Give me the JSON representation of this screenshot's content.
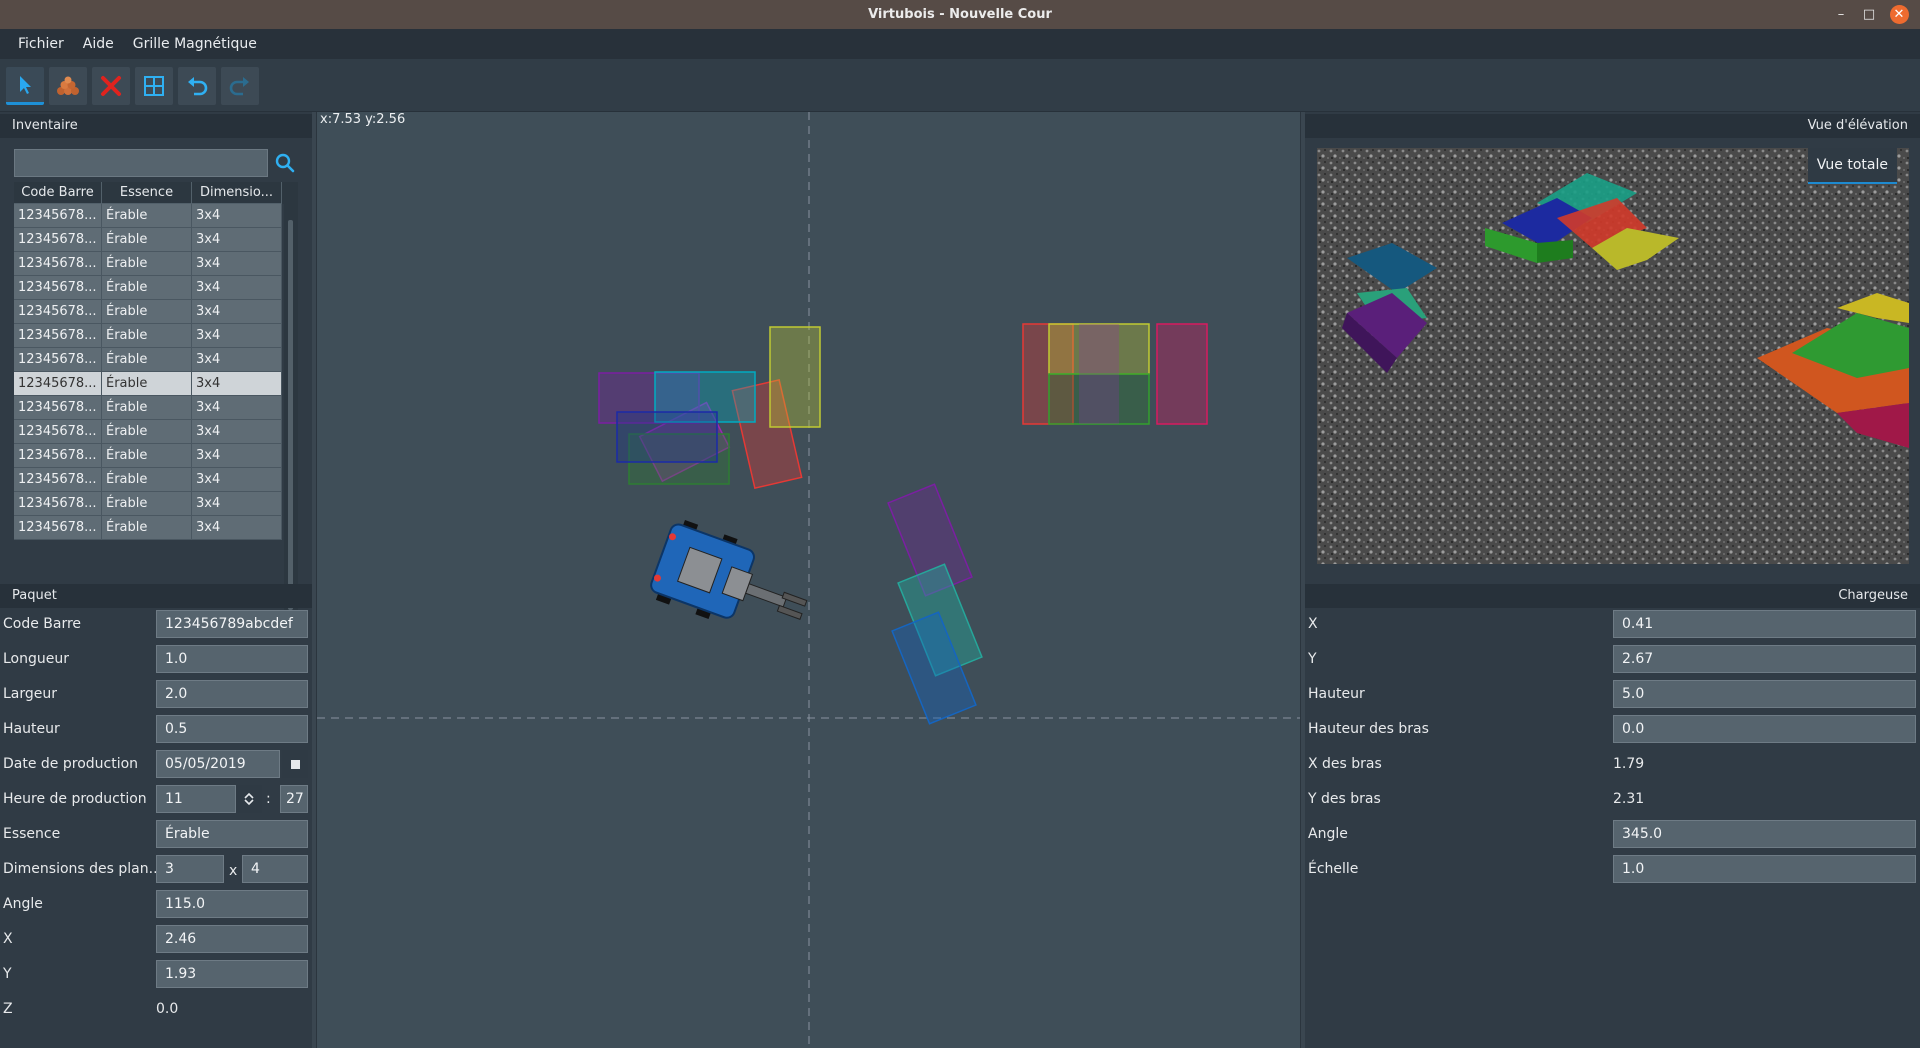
{
  "window": {
    "title": "Virtubois - Nouvelle Cour",
    "minimize": "–",
    "maximize": "□",
    "close": "✕"
  },
  "menu": {
    "items": [
      "Fichier",
      "Aide",
      "Grille Magnétique"
    ]
  },
  "toolbar": {
    "tools": [
      {
        "name": "select-tool",
        "icon": "cursor-arrow-icon",
        "active": true
      },
      {
        "name": "add-package-tool",
        "icon": "lumber-stack-icon",
        "active": false
      },
      {
        "name": "delete-tool",
        "icon": "red-x-icon",
        "active": false
      },
      {
        "name": "grid-tool",
        "icon": "grid-icon",
        "active": false
      },
      {
        "name": "undo-tool",
        "icon": "undo-icon",
        "active": false
      },
      {
        "name": "redo-tool",
        "icon": "redo-icon",
        "active": false
      }
    ]
  },
  "inventory": {
    "title": "Inventaire",
    "search_value": "",
    "columns": [
      "Code Barre",
      "Essence",
      "Dimensio..."
    ],
    "rows": [
      [
        "12345678...",
        "Érable",
        "3x4"
      ],
      [
        "12345678...",
        "Érable",
        "3x4"
      ],
      [
        "12345678...",
        "Érable",
        "3x4"
      ],
      [
        "12345678...",
        "Érable",
        "3x4"
      ],
      [
        "12345678...",
        "Érable",
        "3x4"
      ],
      [
        "12345678...",
        "Érable",
        "3x4"
      ],
      [
        "12345678...",
        "Érable",
        "3x4"
      ],
      [
        "12345678...",
        "Érable",
        "3x4"
      ],
      [
        "12345678...",
        "Érable",
        "3x4"
      ],
      [
        "12345678...",
        "Érable",
        "3x4"
      ],
      [
        "12345678...",
        "Érable",
        "3x4"
      ],
      [
        "12345678...",
        "Érable",
        "3x4"
      ],
      [
        "12345678...",
        "Érable",
        "3x4"
      ],
      [
        "12345678...",
        "Érable",
        "3x4"
      ]
    ],
    "selected_row": 8
  },
  "paquet": {
    "title": "Paquet",
    "code_barre_label": "Code Barre",
    "code_barre": "123456789abcdef",
    "longueur_label": "Longueur",
    "longueur": "1.0",
    "largeur_label": "Largeur",
    "largeur": "2.0",
    "hauteur_label": "Hauteur",
    "hauteur": "0.5",
    "date_label": "Date de production",
    "date": "05/05/2019",
    "heure_label": "Heure de production",
    "heure_h": "11",
    "heure_sep": ":",
    "heure_m": "27",
    "essence_label": "Essence",
    "essence": "Érable",
    "dims_label": "Dimensions des plan...",
    "dim_a": "3",
    "dim_x": "x",
    "dim_b": "4",
    "angle_label": "Angle",
    "angle": "115.0",
    "x_label": "X",
    "x": "2.46",
    "y_label": "Y",
    "y": "1.93",
    "z_label": "Z",
    "z": "0.0"
  },
  "canvas": {
    "coords": "x:7.53  y:2.56"
  },
  "elevation": {
    "title": "Vue d'élévation",
    "vue_totale": "Vue totale"
  },
  "chargeuse": {
    "title": "Chargeuse",
    "x_label": "X",
    "x": "0.41",
    "y_label": "Y",
    "y": "2.67",
    "hauteur_label": "Hauteur",
    "hauteur": "5.0",
    "hauteur_bras_label": "Hauteur des bras",
    "hauteur_bras": "0.0",
    "x_bras_label": "X des bras",
    "x_bras": "1.79",
    "y_bras_label": "Y des bras",
    "y_bras": "2.31",
    "angle_label": "Angle",
    "angle": "345.0",
    "echelle_label": "Échelle",
    "echelle": "1.0"
  },
  "colors": {
    "accent": "#1e90d6",
    "package_colors": [
      "#7b1fa2",
      "#d81b60",
      "#e53935",
      "#c0ca33",
      "#00acc1",
      "#1e3a8a",
      "#2e7d32",
      "#26a69a",
      "#1565c0"
    ]
  }
}
